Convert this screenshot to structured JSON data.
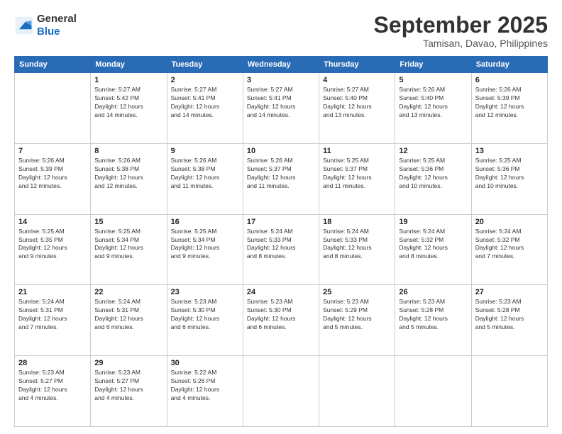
{
  "logo": {
    "line1": "General",
    "line2": "Blue"
  },
  "title": "September 2025",
  "subtitle": "Tamisan, Davao, Philippines",
  "days_of_week": [
    "Sunday",
    "Monday",
    "Tuesday",
    "Wednesday",
    "Thursday",
    "Friday",
    "Saturday"
  ],
  "weeks": [
    [
      {
        "day": "",
        "info": ""
      },
      {
        "day": "1",
        "info": "Sunrise: 5:27 AM\nSunset: 5:42 PM\nDaylight: 12 hours\nand 14 minutes."
      },
      {
        "day": "2",
        "info": "Sunrise: 5:27 AM\nSunset: 5:41 PM\nDaylight: 12 hours\nand 14 minutes."
      },
      {
        "day": "3",
        "info": "Sunrise: 5:27 AM\nSunset: 5:41 PM\nDaylight: 12 hours\nand 14 minutes."
      },
      {
        "day": "4",
        "info": "Sunrise: 5:27 AM\nSunset: 5:40 PM\nDaylight: 12 hours\nand 13 minutes."
      },
      {
        "day": "5",
        "info": "Sunrise: 5:26 AM\nSunset: 5:40 PM\nDaylight: 12 hours\nand 13 minutes."
      },
      {
        "day": "6",
        "info": "Sunrise: 5:26 AM\nSunset: 5:39 PM\nDaylight: 12 hours\nand 12 minutes."
      }
    ],
    [
      {
        "day": "7",
        "info": "Sunrise: 5:26 AM\nSunset: 5:39 PM\nDaylight: 12 hours\nand 12 minutes."
      },
      {
        "day": "8",
        "info": "Sunrise: 5:26 AM\nSunset: 5:38 PM\nDaylight: 12 hours\nand 12 minutes."
      },
      {
        "day": "9",
        "info": "Sunrise: 5:26 AM\nSunset: 5:38 PM\nDaylight: 12 hours\nand 11 minutes."
      },
      {
        "day": "10",
        "info": "Sunrise: 5:26 AM\nSunset: 5:37 PM\nDaylight: 12 hours\nand 11 minutes."
      },
      {
        "day": "11",
        "info": "Sunrise: 5:25 AM\nSunset: 5:37 PM\nDaylight: 12 hours\nand 11 minutes."
      },
      {
        "day": "12",
        "info": "Sunrise: 5:25 AM\nSunset: 5:36 PM\nDaylight: 12 hours\nand 10 minutes."
      },
      {
        "day": "13",
        "info": "Sunrise: 5:25 AM\nSunset: 5:36 PM\nDaylight: 12 hours\nand 10 minutes."
      }
    ],
    [
      {
        "day": "14",
        "info": "Sunrise: 5:25 AM\nSunset: 5:35 PM\nDaylight: 12 hours\nand 9 minutes."
      },
      {
        "day": "15",
        "info": "Sunrise: 5:25 AM\nSunset: 5:34 PM\nDaylight: 12 hours\nand 9 minutes."
      },
      {
        "day": "16",
        "info": "Sunrise: 5:25 AM\nSunset: 5:34 PM\nDaylight: 12 hours\nand 9 minutes."
      },
      {
        "day": "17",
        "info": "Sunrise: 5:24 AM\nSunset: 5:33 PM\nDaylight: 12 hours\nand 8 minutes."
      },
      {
        "day": "18",
        "info": "Sunrise: 5:24 AM\nSunset: 5:33 PM\nDaylight: 12 hours\nand 8 minutes."
      },
      {
        "day": "19",
        "info": "Sunrise: 5:24 AM\nSunset: 5:32 PM\nDaylight: 12 hours\nand 8 minutes."
      },
      {
        "day": "20",
        "info": "Sunrise: 5:24 AM\nSunset: 5:32 PM\nDaylight: 12 hours\nand 7 minutes."
      }
    ],
    [
      {
        "day": "21",
        "info": "Sunrise: 5:24 AM\nSunset: 5:31 PM\nDaylight: 12 hours\nand 7 minutes."
      },
      {
        "day": "22",
        "info": "Sunrise: 5:24 AM\nSunset: 5:31 PM\nDaylight: 12 hours\nand 6 minutes."
      },
      {
        "day": "23",
        "info": "Sunrise: 5:23 AM\nSunset: 5:30 PM\nDaylight: 12 hours\nand 6 minutes."
      },
      {
        "day": "24",
        "info": "Sunrise: 5:23 AM\nSunset: 5:30 PM\nDaylight: 12 hours\nand 6 minutes."
      },
      {
        "day": "25",
        "info": "Sunrise: 5:23 AM\nSunset: 5:29 PM\nDaylight: 12 hours\nand 5 minutes."
      },
      {
        "day": "26",
        "info": "Sunrise: 5:23 AM\nSunset: 5:28 PM\nDaylight: 12 hours\nand 5 minutes."
      },
      {
        "day": "27",
        "info": "Sunrise: 5:23 AM\nSunset: 5:28 PM\nDaylight: 12 hours\nand 5 minutes."
      }
    ],
    [
      {
        "day": "28",
        "info": "Sunrise: 5:23 AM\nSunset: 5:27 PM\nDaylight: 12 hours\nand 4 minutes."
      },
      {
        "day": "29",
        "info": "Sunrise: 5:23 AM\nSunset: 5:27 PM\nDaylight: 12 hours\nand 4 minutes."
      },
      {
        "day": "30",
        "info": "Sunrise: 5:22 AM\nSunset: 5:26 PM\nDaylight: 12 hours\nand 4 minutes."
      },
      {
        "day": "",
        "info": ""
      },
      {
        "day": "",
        "info": ""
      },
      {
        "day": "",
        "info": ""
      },
      {
        "day": "",
        "info": ""
      }
    ]
  ]
}
